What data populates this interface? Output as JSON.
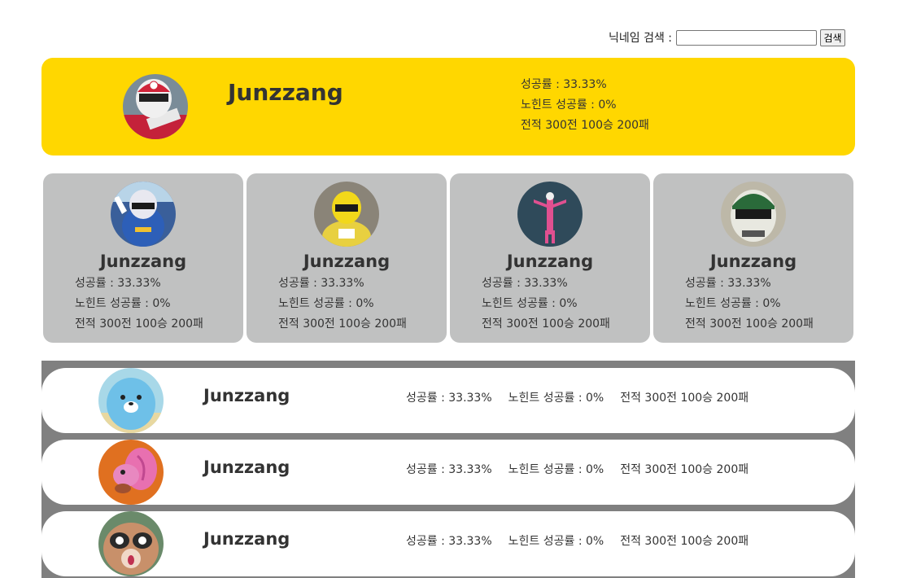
{
  "search": {
    "label": "닉네임 검색 :",
    "value": "",
    "button": "검색"
  },
  "top": {
    "name": "Junzzang",
    "success_rate": "성공률 : 33.33%",
    "nohint_rate": "노힌트 성공률 : 0%",
    "record": "전적 300전 100승 200패",
    "avatar_icon": "red-ranger-avatar-icon"
  },
  "cards": [
    {
      "name": "Junzzang",
      "success_rate": "성공률 : 33.33%",
      "nohint_rate": "노힌트 성공률 : 0%",
      "record": "전적 300전 100승 200패",
      "avatar_icon": "blue-ranger-avatar-icon"
    },
    {
      "name": "Junzzang",
      "success_rate": "성공률 : 33.33%",
      "nohint_rate": "노힌트 성공률 : 0%",
      "record": "전적 300전 100승 200패",
      "avatar_icon": "yellow-ranger-avatar-icon"
    },
    {
      "name": "Junzzang",
      "success_rate": "성공률 : 33.33%",
      "nohint_rate": "노힌트 성공률 : 0%",
      "record": "전적 300전 100승 200패",
      "avatar_icon": "pink-ranger-avatar-icon"
    },
    {
      "name": "Junzzang",
      "success_rate": "성공률 : 33.33%",
      "nohint_rate": "노힌트 성공률 : 0%",
      "record": "전적 300전 100승 200패",
      "avatar_icon": "green-ranger-avatar-icon"
    }
  ],
  "rows": [
    {
      "name": "Junzzang",
      "success_rate": "성공률 : 33.33%",
      "nohint_rate": "노힌트 성공률 : 0%",
      "record": "전적 300전 100승 200패",
      "avatar_icon": "blue-seal-avatar-icon"
    },
    {
      "name": "Junzzang",
      "success_rate": "성공률 : 33.33%",
      "nohint_rate": "노힌트 성공률 : 0%",
      "record": "전적 300전 100승 200패",
      "avatar_icon": "pink-squirrel-avatar-icon"
    },
    {
      "name": "Junzzang",
      "success_rate": "성공률 : 33.33%",
      "nohint_rate": "노힌트 성공률 : 0%",
      "record": "전적 300전 100승 200패",
      "avatar_icon": "raccoon-avatar-icon"
    }
  ]
}
